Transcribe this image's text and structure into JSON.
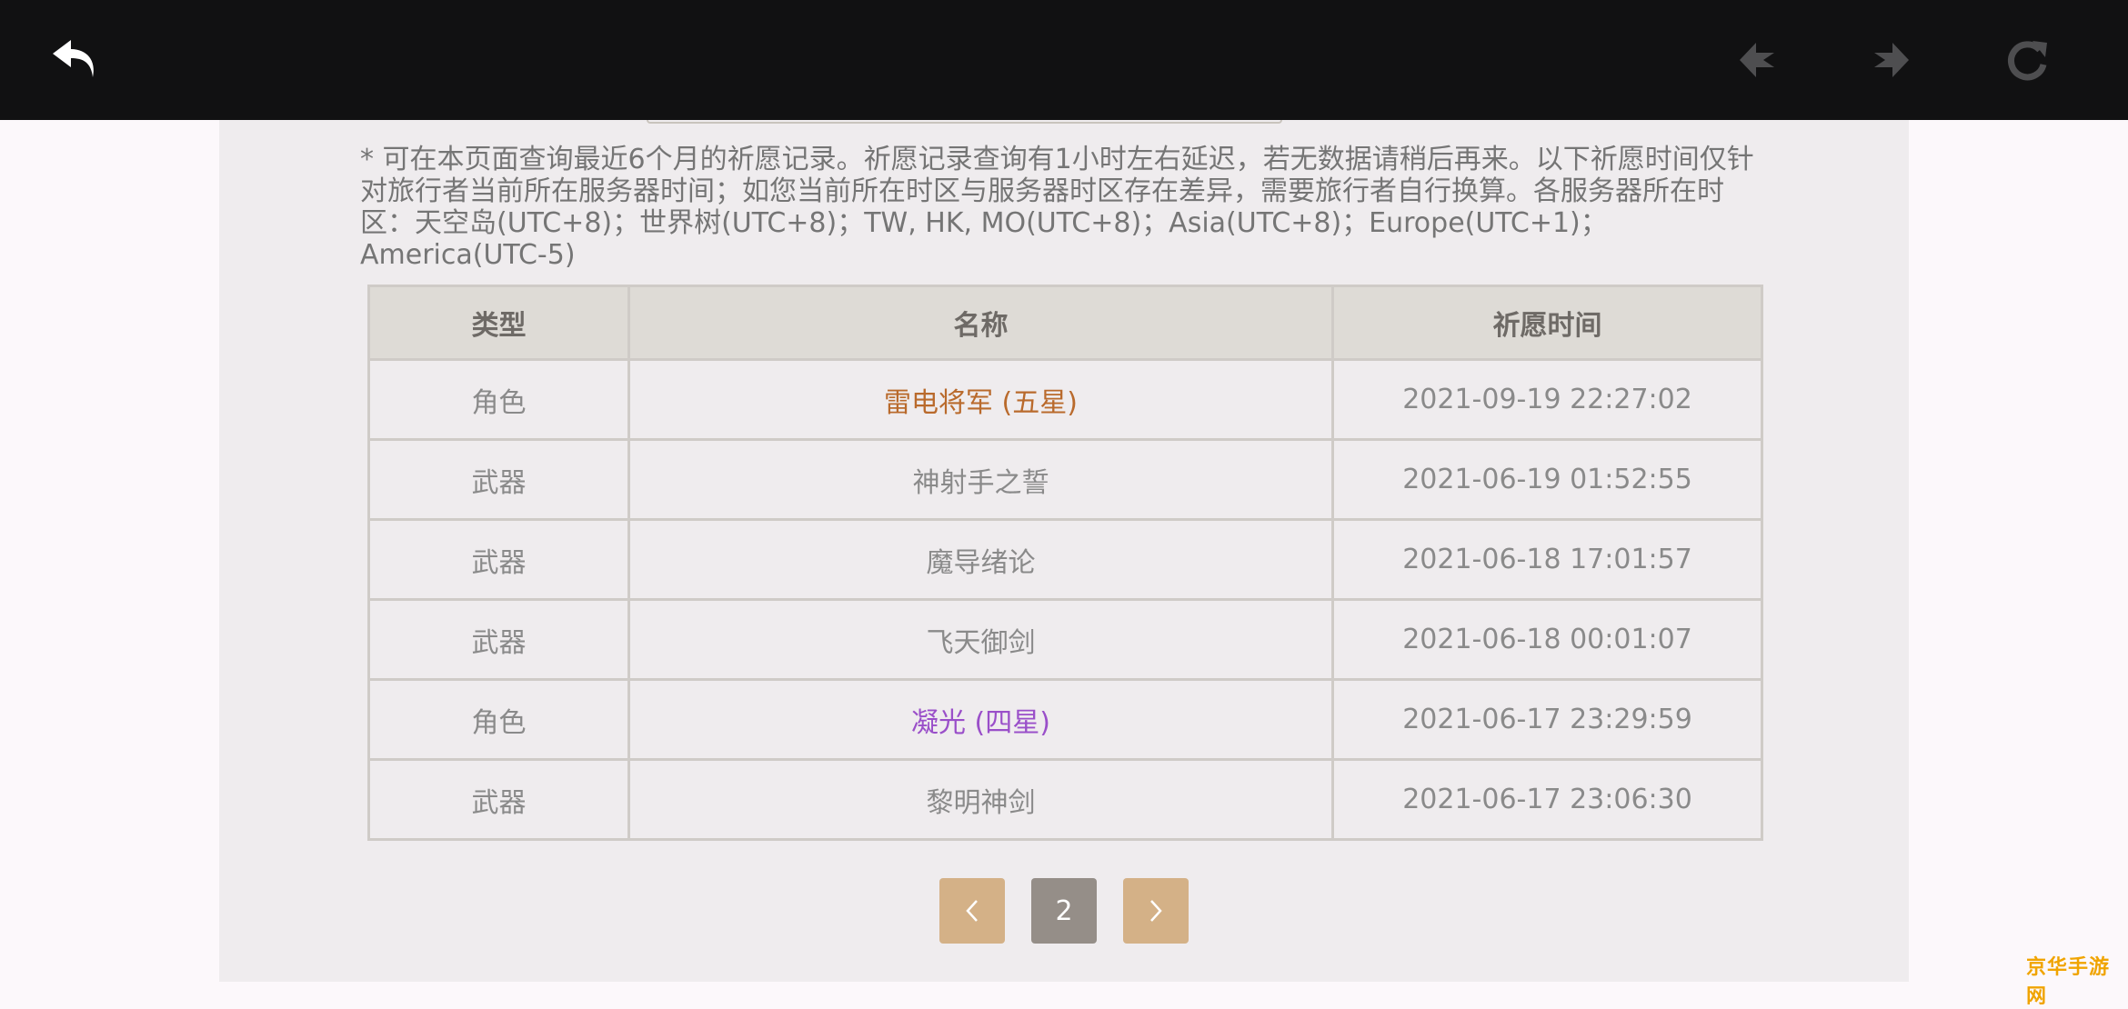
{
  "browser": {
    "back_icon": "undo-arrow-icon",
    "prev_icon": "page-back-icon",
    "next_icon": "page-forward-icon",
    "reload_icon": "reload-icon",
    "colors": {
      "bar": "#111112",
      "active_icon": "#ffffff",
      "disabled_icon": "#4e4e50"
    }
  },
  "notice": "* 可在本页面查询最近6个月的祈愿记录。祈愿记录查询有1小时左右延迟，若无数据请稍后再来。以下祈愿时间仅针对旅行者当前所在服务器时间；如您当前所在时区与服务器时区存在差异，需要旅行者自行换算。各服务器所在时区：天空岛(UTC+8)；世界树(UTC+8)；TW, HK, MO(UTC+8)；Asia(UTC+8)；Europe(UTC+1)；America(UTC-5)",
  "table": {
    "headers": [
      "类型",
      "名称",
      "祈愿时间"
    ],
    "rows": [
      {
        "type": "角色",
        "name": "雷电将军 (五星)",
        "time": "2021-09-19 22:27:02",
        "rarity": "five"
      },
      {
        "type": "武器",
        "name": "神射手之誓",
        "time": "2021-06-19 01:52:55",
        "rarity": "normal"
      },
      {
        "type": "武器",
        "name": "魔导绪论",
        "time": "2021-06-18 17:01:57",
        "rarity": "normal"
      },
      {
        "type": "武器",
        "name": "飞天御剑",
        "time": "2021-06-18 00:01:07",
        "rarity": "normal"
      },
      {
        "type": "角色",
        "name": "凝光 (四星)",
        "time": "2021-06-17 23:29:59",
        "rarity": "four"
      },
      {
        "type": "武器",
        "name": "黎明神剑",
        "time": "2021-06-17 23:06:30",
        "rarity": "normal"
      }
    ],
    "colors": {
      "five_star": "#b96a2c",
      "four_star": "#9a4fc9",
      "normal": "#8a8a8a",
      "header_bg": "#dedbd6"
    }
  },
  "pagination": {
    "prev_icon": "chevron-left-icon",
    "current_page": "2",
    "next_icon": "chevron-right-icon",
    "colors": {
      "nav": "#d4b187",
      "current": "#958e88"
    }
  },
  "watermark": "京华手游网"
}
